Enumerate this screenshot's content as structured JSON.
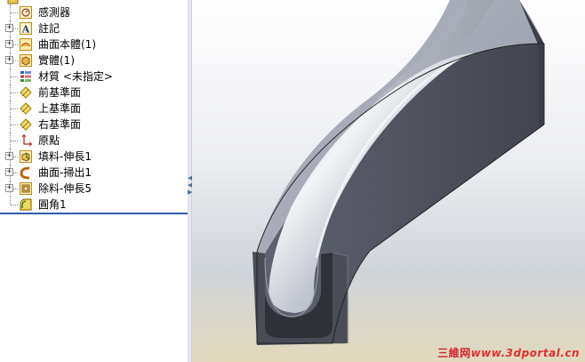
{
  "feature_tree": {
    "items": [
      {
        "label": "感測器",
        "icon": "sensor-icon",
        "has_expander": false
      },
      {
        "label": "註記",
        "icon": "annotations-icon",
        "has_expander": true
      },
      {
        "label": "曲面本體(1)",
        "icon": "surface-bodies-icon",
        "has_expander": true
      },
      {
        "label": "實體(1)",
        "icon": "solid-bodies-icon",
        "has_expander": true
      },
      {
        "label": "材質 <未指定>",
        "icon": "material-icon",
        "has_expander": false
      },
      {
        "label": "前基準面",
        "icon": "plane-icon",
        "has_expander": false
      },
      {
        "label": "上基準面",
        "icon": "plane-icon",
        "has_expander": false
      },
      {
        "label": "右基準面",
        "icon": "plane-icon",
        "has_expander": false
      },
      {
        "label": "原點",
        "icon": "origin-icon",
        "has_expander": false
      },
      {
        "label": "填料-伸長1",
        "icon": "extrude-boss-icon",
        "has_expander": true
      },
      {
        "label": "曲面-掃出1",
        "icon": "surface-sweep-icon",
        "has_expander": true
      },
      {
        "label": "除料-伸長5",
        "icon": "extrude-cut-icon",
        "has_expander": true
      },
      {
        "label": "圓角1",
        "icon": "fillet-icon",
        "has_expander": false
      }
    ]
  },
  "viewport": {
    "model": "curved-channel-part"
  },
  "watermark": {
    "cn": "三維网",
    "url": "www.3dportal.cn"
  },
  "colors": {
    "rollback_bar": "#2e5fa8",
    "watermark": "#d2242a"
  }
}
